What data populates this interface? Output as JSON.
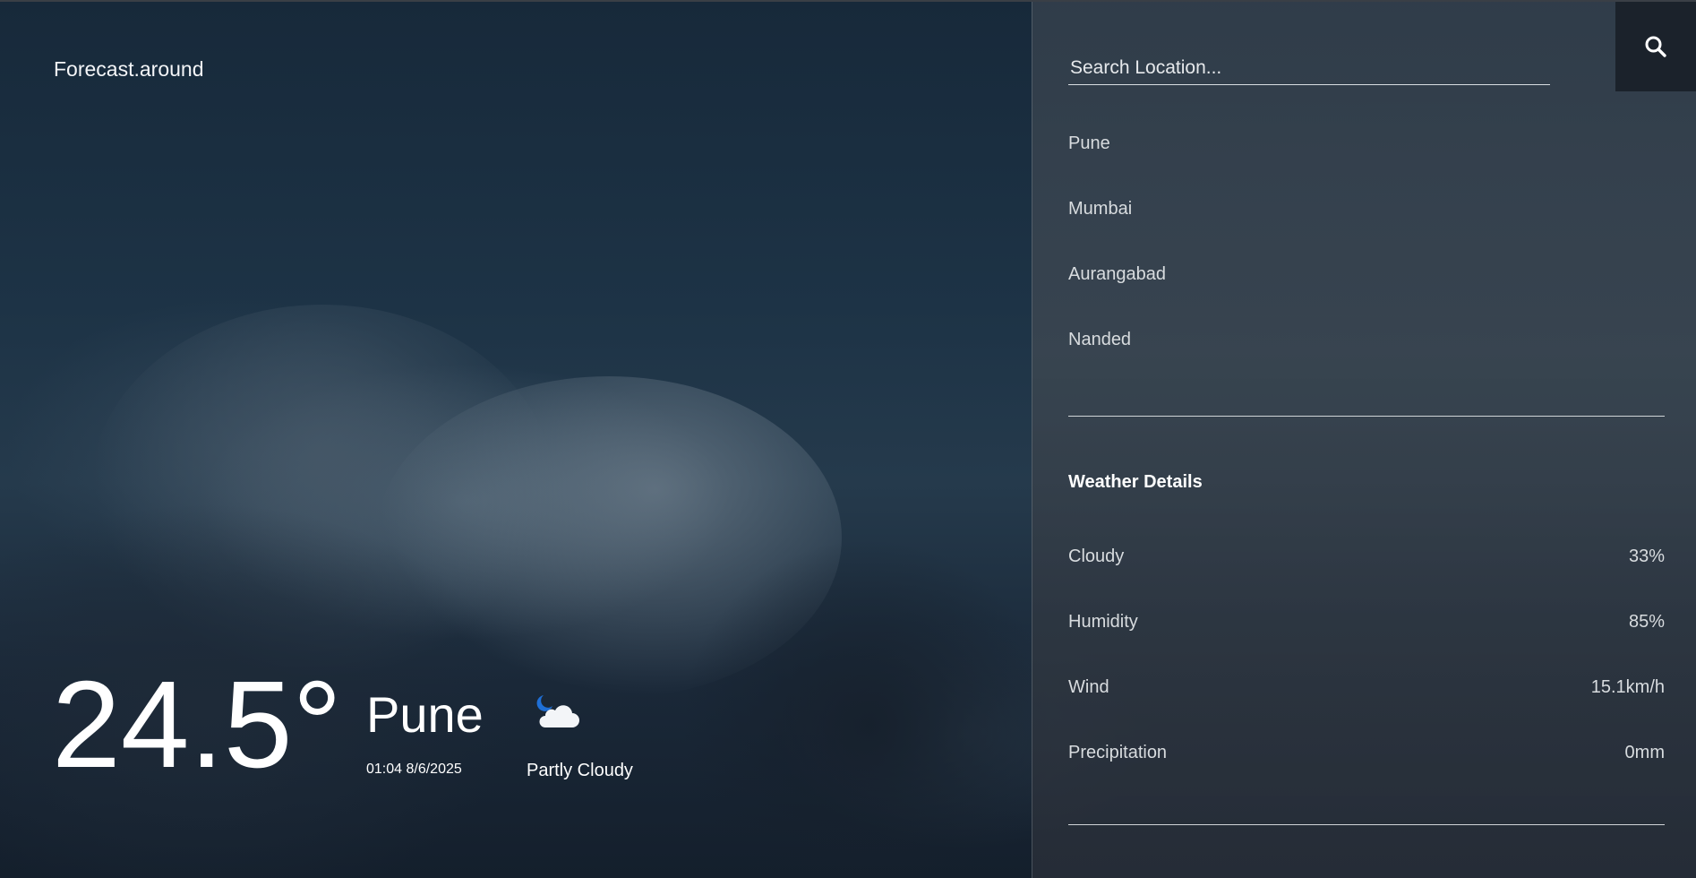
{
  "app": {
    "brand": "Forecast.around"
  },
  "current": {
    "temperature": "24.5°",
    "city": "Pune",
    "datetime": "01:04 8/6/2025",
    "condition": "Partly Cloudy",
    "condition_icon": "moon-cloud-icon"
  },
  "search": {
    "placeholder": "Search Location...",
    "value": "",
    "button_icon": "search-icon"
  },
  "locations": [
    {
      "label": "Pune"
    },
    {
      "label": "Mumbai"
    },
    {
      "label": "Aurangabad"
    },
    {
      "label": "Nanded"
    }
  ],
  "details": {
    "title": "Weather Details",
    "rows": [
      {
        "label": "Cloudy",
        "value": "33%"
      },
      {
        "label": "Humidity",
        "value": "85%"
      },
      {
        "label": "Wind",
        "value": "15.1km/h"
      },
      {
        "label": "Precipitation",
        "value": "0mm"
      }
    ]
  },
  "colors": {
    "sky_dark": "#17293a",
    "panel_bg": "#3e4852",
    "search_button_bg": "#1b222b",
    "text": "#ffffff",
    "muted_text": "#d8dcdf",
    "moon": "#1f6fd6"
  }
}
